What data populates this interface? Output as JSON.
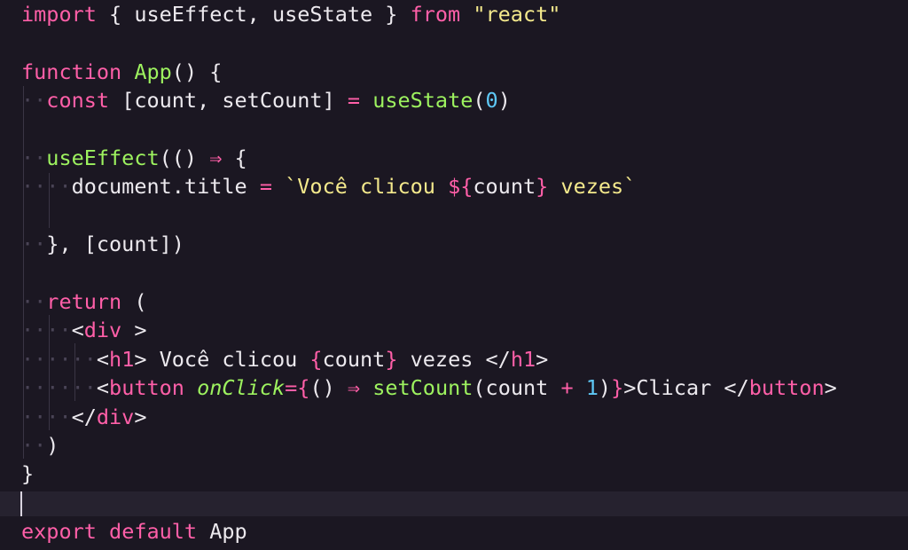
{
  "editor": {
    "language": "jsx",
    "colors": {
      "background": "#1b1722",
      "keyword": "#ff5fa8",
      "function": "#9df25f",
      "string": "#f4e98c",
      "number": "#5ec8f6",
      "text": "#ece9ee"
    },
    "lines": [
      {
        "segments": [
          {
            "t": "import",
            "c": "kw"
          },
          {
            "t": " { useEffect, useState } ",
            "c": "plain"
          },
          {
            "t": "from",
            "c": "kw"
          },
          {
            "t": " ",
            "c": "plain"
          },
          {
            "t": "\"react\"",
            "c": "str"
          }
        ]
      },
      {
        "segments": []
      },
      {
        "segments": [
          {
            "t": "function",
            "c": "kw"
          },
          {
            "t": " ",
            "c": "plain"
          },
          {
            "t": "App",
            "c": "fn"
          },
          {
            "t": "() {",
            "c": "plain"
          }
        ]
      },
      {
        "segments": [
          {
            "t": "··",
            "c": "ws"
          },
          {
            "t": "const",
            "c": "kw"
          },
          {
            "t": " [count, setCount] ",
            "c": "plain"
          },
          {
            "t": "=",
            "c": "op"
          },
          {
            "t": " ",
            "c": "plain"
          },
          {
            "t": "useState",
            "c": "fn"
          },
          {
            "t": "(",
            "c": "plain"
          },
          {
            "t": "0",
            "c": "num"
          },
          {
            "t": ")",
            "c": "plain"
          }
        ]
      },
      {
        "segments": []
      },
      {
        "segments": [
          {
            "t": "··",
            "c": "ws"
          },
          {
            "t": "useEffect",
            "c": "fn"
          },
          {
            "t": "(() ",
            "c": "plain"
          },
          {
            "t": "⇒",
            "c": "op"
          },
          {
            "t": " {",
            "c": "plain"
          }
        ]
      },
      {
        "segments": [
          {
            "t": "····",
            "c": "ws"
          },
          {
            "t": "document.title ",
            "c": "plain"
          },
          {
            "t": "=",
            "c": "op"
          },
          {
            "t": " ",
            "c": "plain"
          },
          {
            "t": "`Você clicou ",
            "c": "str"
          },
          {
            "t": "${",
            "c": "kw"
          },
          {
            "t": "count",
            "c": "plain"
          },
          {
            "t": "}",
            "c": "kw"
          },
          {
            "t": " vezes`",
            "c": "str"
          }
        ]
      },
      {
        "segments": []
      },
      {
        "segments": [
          {
            "t": "··",
            "c": "ws"
          },
          {
            "t": "}, [count])",
            "c": "plain"
          }
        ]
      },
      {
        "segments": []
      },
      {
        "segments": [
          {
            "t": "··",
            "c": "ws"
          },
          {
            "t": "return",
            "c": "kw"
          },
          {
            "t": " (",
            "c": "plain"
          }
        ]
      },
      {
        "segments": [
          {
            "t": "····",
            "c": "ws"
          },
          {
            "t": "<",
            "c": "plain"
          },
          {
            "t": "div",
            "c": "kw"
          },
          {
            "t": " >",
            "c": "plain"
          }
        ]
      },
      {
        "segments": [
          {
            "t": "······",
            "c": "ws"
          },
          {
            "t": "<",
            "c": "plain"
          },
          {
            "t": "h1",
            "c": "kw"
          },
          {
            "t": "> Você clicou ",
            "c": "plain"
          },
          {
            "t": "{",
            "c": "kw"
          },
          {
            "t": "count",
            "c": "plain"
          },
          {
            "t": "}",
            "c": "kw"
          },
          {
            "t": " vezes </",
            "c": "plain"
          },
          {
            "t": "h1",
            "c": "kw"
          },
          {
            "t": ">",
            "c": "plain"
          }
        ]
      },
      {
        "segments": [
          {
            "t": "······",
            "c": "ws"
          },
          {
            "t": "<",
            "c": "plain"
          },
          {
            "t": "button",
            "c": "kw"
          },
          {
            "t": " ",
            "c": "plain"
          },
          {
            "t": "onClick",
            "c": "attr"
          },
          {
            "t": "=",
            "c": "op"
          },
          {
            "t": "{",
            "c": "kw"
          },
          {
            "t": "() ",
            "c": "plain"
          },
          {
            "t": "⇒",
            "c": "op"
          },
          {
            "t": " ",
            "c": "plain"
          },
          {
            "t": "setCount",
            "c": "fn"
          },
          {
            "t": "(count ",
            "c": "plain"
          },
          {
            "t": "+",
            "c": "op"
          },
          {
            "t": " ",
            "c": "plain"
          },
          {
            "t": "1",
            "c": "num"
          },
          {
            "t": ")",
            "c": "plain"
          },
          {
            "t": "}",
            "c": "kw"
          },
          {
            "t": ">Clicar </",
            "c": "plain"
          },
          {
            "t": "button",
            "c": "kw"
          },
          {
            "t": ">",
            "c": "plain"
          }
        ]
      },
      {
        "segments": [
          {
            "t": "····",
            "c": "ws"
          },
          {
            "t": "</",
            "c": "plain"
          },
          {
            "t": "div",
            "c": "kw"
          },
          {
            "t": ">",
            "c": "plain"
          }
        ]
      },
      {
        "segments": [
          {
            "t": "··",
            "c": "ws"
          },
          {
            "t": ")",
            "c": "plain"
          }
        ]
      },
      {
        "segments": [
          {
            "t": "}",
            "c": "plain"
          }
        ]
      },
      {
        "segments": []
      },
      {
        "segments": [
          {
            "t": "export",
            "c": "kw"
          },
          {
            "t": " ",
            "c": "plain"
          },
          {
            "t": "default",
            "c": "kw"
          },
          {
            "t": " App",
            "c": "plain"
          }
        ]
      }
    ]
  }
}
